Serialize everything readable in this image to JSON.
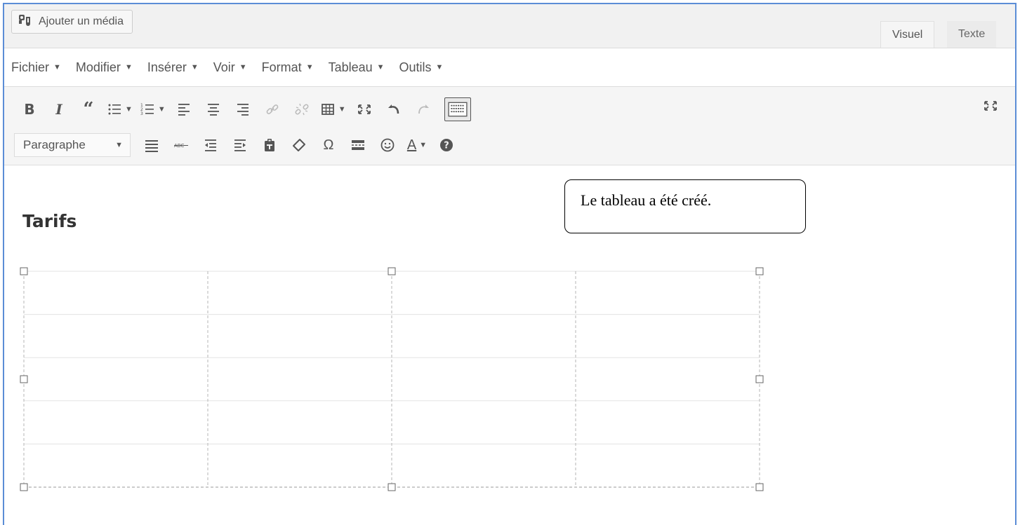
{
  "media_button": {
    "label": "Ajouter un média",
    "icon": "media-add-icon"
  },
  "tabs": [
    {
      "label": "Visuel",
      "active": true
    },
    {
      "label": "Texte",
      "active": false
    }
  ],
  "menubar": {
    "items": [
      {
        "label": "Fichier"
      },
      {
        "label": "Modifier"
      },
      {
        "label": "Insérer"
      },
      {
        "label": "Voir"
      },
      {
        "label": "Format"
      },
      {
        "label": "Tableau"
      },
      {
        "label": "Outils"
      }
    ]
  },
  "toolbar": {
    "bold_glyph": "B",
    "italic_glyph": "I",
    "quote_glyph": "“",
    "format_select": {
      "value": "Paragraphe"
    },
    "omega_glyph": "Ω",
    "text_color_glyph": "A"
  },
  "content": {
    "heading": "Tarifs",
    "table": {
      "rows": 5,
      "cols": 4
    }
  },
  "callout": {
    "text": "Le tableau a été créé."
  },
  "colors": {
    "frame": "#5b8dd6",
    "toolbar_bg": "#f5f5f5",
    "text": "#555555"
  }
}
